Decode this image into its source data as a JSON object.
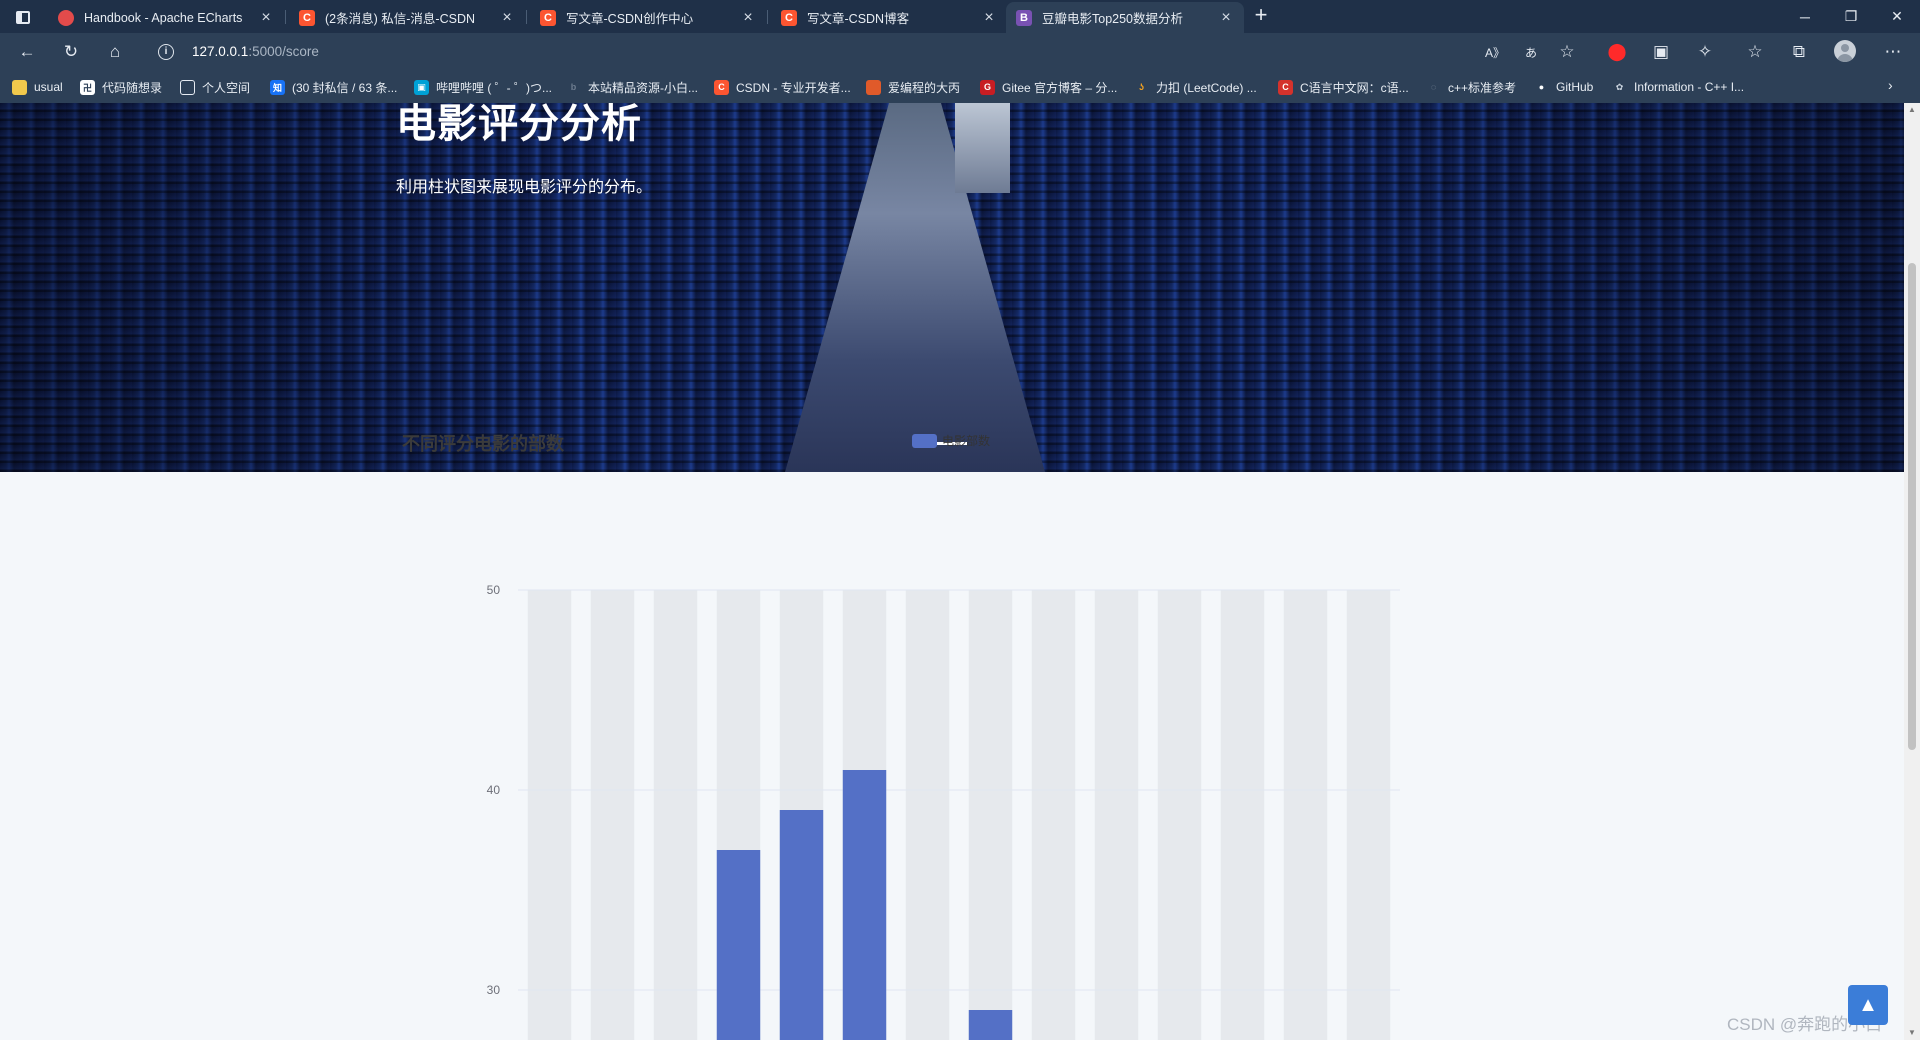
{
  "browser": {
    "tabs": [
      {
        "title": "Handbook - Apache ECharts",
        "icon": "echarts-favicon",
        "color": "#e34b4b",
        "glyph": "●",
        "active": false
      },
      {
        "title": "(2条消息) 私信-消息-CSDN",
        "icon": "csdn-favicon",
        "color": "#fc5531",
        "glyph": "C",
        "active": false
      },
      {
        "title": "写文章-CSDN创作中心",
        "icon": "csdn-favicon",
        "color": "#fc5531",
        "glyph": "C",
        "active": false
      },
      {
        "title": "写文章-CSDN博客",
        "icon": "csdn-favicon",
        "color": "#fc5531",
        "glyph": "C",
        "active": false
      },
      {
        "title": "豆瓣电影Top250数据分析",
        "icon": "bootstrap-favicon",
        "color": "#7952b3",
        "glyph": "B",
        "active": true
      }
    ],
    "address": {
      "host": "127.0.0.1",
      "path": ":5000/score"
    },
    "bookmarks": [
      {
        "label": "usual",
        "icon": "folder-icon",
        "color": "#f2c94c",
        "glyph": ""
      },
      {
        "label": "代码随想录",
        "icon": "bookmark-favicon",
        "color": "#ffffff",
        "glyph": "卍"
      },
      {
        "label": "个人空间",
        "icon": "page-icon",
        "color": "#2d4057",
        "glyph": "▯"
      },
      {
        "label": "(30 封私信 / 63 条...",
        "icon": "zhihu-favicon",
        "color": "#1772f6",
        "glyph": "知"
      },
      {
        "label": "哔哩哔哩 ( ゜- ゜)つ...",
        "icon": "bilibili-favicon",
        "color": "#00a1d6",
        "glyph": "▣"
      },
      {
        "label": "本站精品资源-小白...",
        "icon": "site-favicon",
        "color": "#2d4057",
        "glyph": "b"
      },
      {
        "label": "CSDN - 专业开发者...",
        "icon": "csdn-favicon",
        "color": "#fc5531",
        "glyph": "C"
      },
      {
        "label": "爱编程的大丙",
        "icon": "blog-favicon",
        "color": "#e05a2a",
        "glyph": "▦"
      },
      {
        "label": "Gitee 官方博客 – 分...",
        "icon": "gitee-favicon",
        "color": "#c71d23",
        "glyph": "G"
      },
      {
        "label": "力扣 (LeetCode) ...",
        "icon": "leetcode-favicon",
        "color": "#2d4057",
        "glyph": "ʖ"
      },
      {
        "label": "C语言中文网：c语...",
        "icon": "c-favicon",
        "color": "#d4322c",
        "glyph": "C"
      },
      {
        "label": "c++标准参考",
        "icon": "ref-favicon",
        "color": "#2d4057",
        "glyph": "◌"
      },
      {
        "label": "GitHub",
        "icon": "github-icon",
        "color": "#2d4057",
        "glyph": "●"
      },
      {
        "label": "Information - C++ I...",
        "icon": "cplusplus-favicon",
        "color": "#2d4057",
        "glyph": "✿"
      }
    ]
  },
  "hero": {
    "title": "电影评分分析",
    "subtitle": "利用柱状图来展现电影评分的分布。"
  },
  "chart_data": {
    "type": "bar",
    "title": "不同评分电影的部数",
    "legend": [
      "电影部数"
    ],
    "legend_position": "top-center",
    "series": [
      {
        "name": "电影部数",
        "color": "#5470c6",
        "values": [
          null,
          null,
          null,
          37,
          39,
          41,
          null,
          29,
          null,
          null,
          null,
          null,
          null,
          null
        ]
      }
    ],
    "y_ticks": [
      "50",
      "40",
      "30"
    ],
    "ylim_visible": [
      27.5,
      50
    ],
    "grid": true,
    "background_bars": true
  },
  "watermark": "CSDN @奔跑的小白",
  "back_to_top": "▲"
}
